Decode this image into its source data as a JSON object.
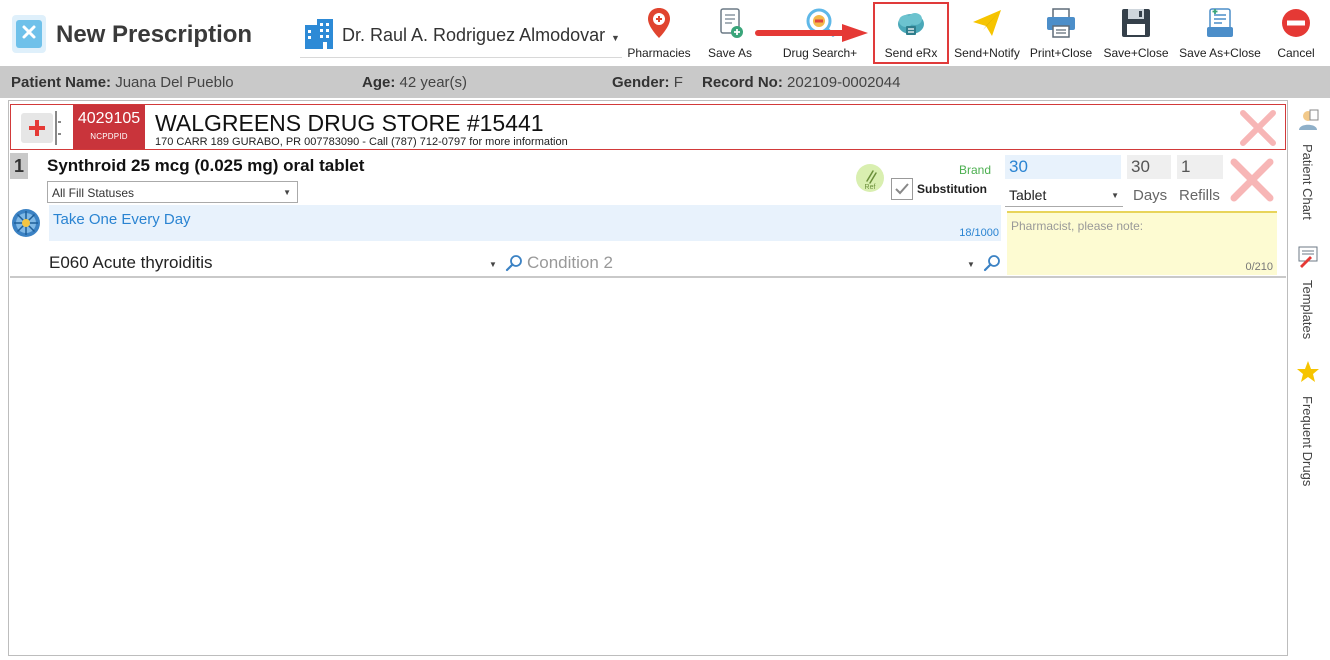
{
  "header": {
    "title": "New Prescription",
    "doctor": "Dr. Raul A. Rodriguez Almodovar"
  },
  "toolbar": {
    "pharmacies": "Pharmacies",
    "save_as": "Save As",
    "drug_search": "Drug Search+",
    "send_erx": "Send eRx",
    "send_notify": "Send+Notify",
    "print_close": "Print+Close",
    "save_close": "Save+Close",
    "save_as_close": "Save As+Close",
    "cancel": "Cancel"
  },
  "patient": {
    "name_label": "Patient Name:",
    "name": "Juana Del Pueblo",
    "age_label": "Age:",
    "age": "42 year(s)",
    "gender_label": "Gender:",
    "gender": "F",
    "record_label": "Record No:",
    "record": "202109-0002044"
  },
  "pharmacy": {
    "ncpdpid": "4029105",
    "ncpdpid_caption": "NCPDPID",
    "name": "WALGREENS DRUG STORE #15441",
    "address": "170 CARR 189 GURABO, PR 007783090 - Call (787) 712-0797 for more information"
  },
  "drug": {
    "number": "1",
    "name": "Synthroid 25 mcg (0.025 mg) oral tablet",
    "fill_status": "All Fill Statuses",
    "ref_label": "Ref",
    "brand": "Brand",
    "substitution": "Substitution",
    "quantity": "30",
    "days": "30",
    "refills": "1",
    "unit": "Tablet",
    "days_label": "Days",
    "refills_label": "Refills",
    "sig": "Take One Every Day",
    "sig_count": "18/1000",
    "note_placeholder": "Pharmacist, please note:",
    "note_count": "0/210",
    "condition1": "E060 Acute thyroiditis",
    "condition2_placeholder": "Condition 2"
  },
  "side_tabs": {
    "patient_chart": "Patient Chart",
    "templates": "Templates",
    "frequent_drugs": "Frequent Drugs"
  },
  "colors": {
    "accent_blue": "#2a84d2",
    "pharmacy_red": "#c9343b",
    "highlight_red": "#e03a3a",
    "bar_gray": "#c9c9c9"
  }
}
